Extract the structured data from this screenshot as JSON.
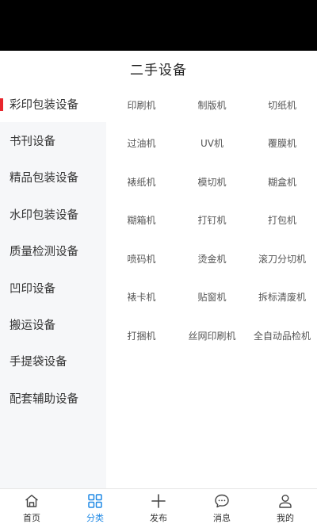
{
  "header": {
    "title": "二手设备"
  },
  "sidebar": {
    "items": [
      {
        "label": "彩印包装设备",
        "active": true
      },
      {
        "label": "书刊设备"
      },
      {
        "label": "精品包装设备"
      },
      {
        "label": "水印包装设备"
      },
      {
        "label": "质量检测设备"
      },
      {
        "label": "凹印设备"
      },
      {
        "label": "搬运设备"
      },
      {
        "label": "手提袋设备"
      },
      {
        "label": "配套辅助设备"
      }
    ]
  },
  "content": {
    "items": [
      "印刷机",
      "制版机",
      "切纸机",
      "过油机",
      "UV机",
      "覆膜机",
      "裱纸机",
      "模切机",
      "糊盒机",
      "糊箱机",
      "打钉机",
      "打包机",
      "喷码机",
      "烫金机",
      "滚刀分切机",
      "裱卡机",
      "贴窗机",
      "拆标清废机",
      "打捆机",
      "丝网印刷机",
      "全自动品检机"
    ]
  },
  "tabbar": {
    "tabs": [
      {
        "label": "首页",
        "icon": "home-icon"
      },
      {
        "label": "分类",
        "icon": "category-icon",
        "active": true
      },
      {
        "label": "发布",
        "icon": "plus-icon"
      },
      {
        "label": "消息",
        "icon": "message-icon"
      },
      {
        "label": "我的",
        "icon": "user-icon"
      }
    ]
  },
  "colors": {
    "accent": "#1e88e5",
    "active_marker": "#e8262d",
    "sidebar_bg": "#f6f7f9"
  }
}
